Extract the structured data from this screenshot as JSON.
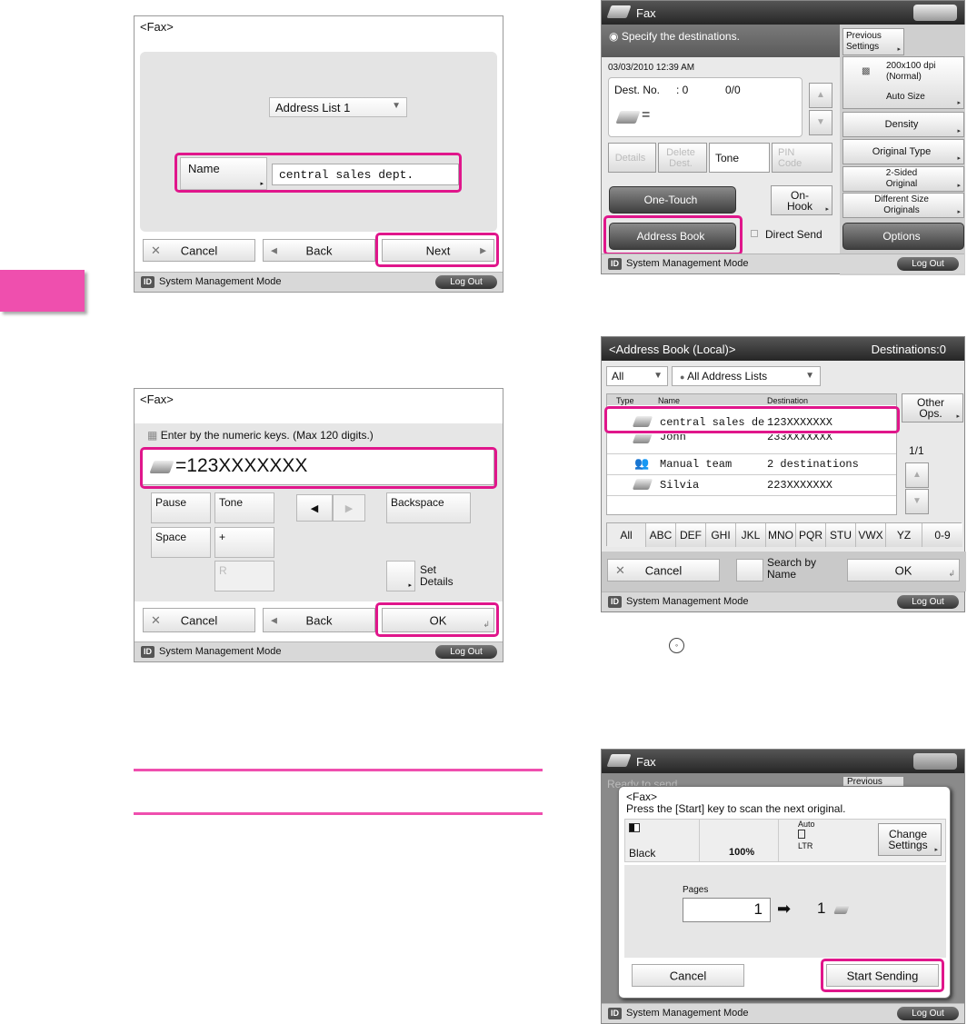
{
  "common": {
    "sys_mode": "System Management Mode",
    "logout": "Log Out",
    "id_badge": "ID"
  },
  "screen1": {
    "title": "<Fax>",
    "dropdown": "Address List 1",
    "name_btn": "Name",
    "name_value": "central sales dept.",
    "cancel": "Cancel",
    "back": "Back",
    "next": "Next"
  },
  "screen2": {
    "title": "<Fax>",
    "instruction": "Enter by the numeric keys. (Max 120 digits.)",
    "number": "=123XXXXXXX",
    "keys": {
      "pause": "Pause",
      "tone": "Tone",
      "backspace": "Backspace",
      "space": "Space",
      "plus": "+",
      "r": "R",
      "set_details": "Set\nDetails"
    },
    "cancel": "Cancel",
    "back": "Back",
    "ok": "OK"
  },
  "screen3": {
    "title": "Fax",
    "status": "Specify the destinations.",
    "datetime": "03/03/2010 12:39 AM",
    "dest_no_label": "Dest. No.",
    "dest_no_value": ": 0",
    "dest_count": "0/0",
    "equals": "=",
    "btn_details": "Details",
    "btn_delete": "Delete\nDest.",
    "btn_tone": "Tone",
    "btn_pin": "PIN\nCode",
    "one_touch": "One-Touch",
    "on_hook": "On-\nHook",
    "address_book": "Address Book",
    "direct_send": "Direct Send",
    "prev_settings": "Previous\nSettings",
    "resolution": "200x100 dpi\n(Normal)",
    "auto_size": "Auto Size",
    "density": "Density",
    "original_type": "Original Type",
    "two_sided": "2-Sided\nOriginal",
    "diff_size": "Different Size\nOriginals",
    "options": "Options"
  },
  "screen4": {
    "title": "<Address Book (Local)>",
    "destinations": "Destinations:0",
    "filter_all": "All",
    "filter_lists": "All Address Lists",
    "col_type": "Type",
    "col_name": "Name",
    "col_dest": "Destination",
    "other_ops": "Other\nOps.",
    "page": "1/1",
    "rows": [
      {
        "name": "central sales de",
        "dest": "123XXXXXXX"
      },
      {
        "name": "John",
        "dest": "233XXXXXXX"
      },
      {
        "name": "Manual team",
        "dest": "2 destinations"
      },
      {
        "name": "Silvia",
        "dest": "223XXXXXXX"
      }
    ],
    "letters": [
      "All",
      "ABC",
      "DEF",
      "GHI",
      "JKL",
      "MNO",
      "PQR",
      "STU",
      "VWX",
      "YZ",
      "0-9"
    ],
    "cancel": "Cancel",
    "search_by_name": "Search by\nName",
    "ok": "OK"
  },
  "screen5": {
    "title": "Fax",
    "bg_status": "Ready to send",
    "bg_prev": "Previous",
    "dlg_title": "<Fax>",
    "dlg_msg": "Press the [Start] key to scan the next original.",
    "color": "Black",
    "zoom": "100%",
    "auto": "Auto",
    "ltr": "LTR",
    "change_settings": "Change\nSettings",
    "pages_label": "Pages",
    "pages_value": "1",
    "pages_sent": "1",
    "cancel": "Cancel",
    "start_sending": "Start Sending"
  },
  "colors": {
    "highlight": "#e0168b",
    "tab": "#ef4fae"
  }
}
